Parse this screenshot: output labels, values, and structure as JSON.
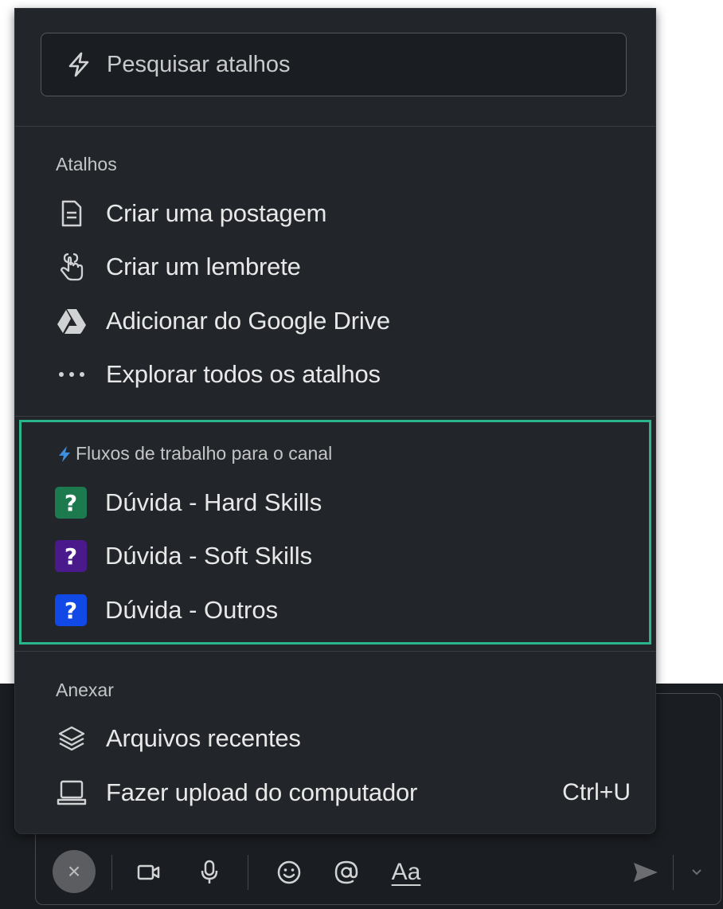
{
  "search": {
    "placeholder": "Pesquisar atalhos"
  },
  "shortcuts": {
    "heading": "Atalhos",
    "items": [
      {
        "label": "Criar uma postagem",
        "icon": "document-icon"
      },
      {
        "label": "Criar um lembrete",
        "icon": "reminder-hand-icon"
      },
      {
        "label": "Adicionar do Google Drive",
        "icon": "google-drive-icon"
      },
      {
        "label": "Explorar todos os atalhos",
        "icon": "more-dots-icon"
      }
    ]
  },
  "workflows": {
    "heading": "Fluxos de trabalho para o canal",
    "highlight_color": "#2bb58a",
    "items": [
      {
        "label": "Dúvida - Hard Skills",
        "badge": "?",
        "color": "#1d7a4f"
      },
      {
        "label": "Dúvida - Soft Skills",
        "badge": "?",
        "color": "#4a1a8c"
      },
      {
        "label": "Dúvida - Outros",
        "badge": "?",
        "color": "#1149e6"
      }
    ]
  },
  "attach": {
    "heading": "Anexar",
    "items": [
      {
        "label": "Arquivos recentes",
        "icon": "layers-icon",
        "shortcut": ""
      },
      {
        "label": "Fazer upload do computador",
        "icon": "laptop-icon",
        "shortcut": "Ctrl+U"
      }
    ]
  },
  "composer": {
    "close_glyph": "×",
    "format_label": "Aa"
  },
  "colors": {
    "popup_bg": "#222529",
    "text": "#e8e8e8",
    "accent": "#2bb58a"
  }
}
